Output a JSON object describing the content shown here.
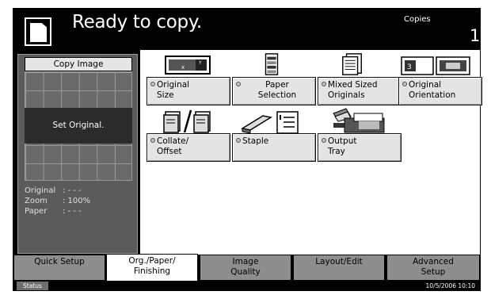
{
  "header": {
    "status_message": "Ready to copy.",
    "copies_label": "Copies",
    "copies_value": "1"
  },
  "preview": {
    "title": "Copy Image",
    "message": "Set Original.",
    "info": [
      {
        "label": "Original",
        "value": ": - - -"
      },
      {
        "label": "Zoom",
        "value": ": 100%"
      },
      {
        "label": "Paper",
        "value": ": - - -"
      }
    ]
  },
  "functions": {
    "original_size": "Original\nSize",
    "paper_selection": "Paper\nSelection",
    "mixed_sized_originals": "Mixed Sized\nOriginals",
    "original_orientation": "Original\nOrientation",
    "collate_offset": "Collate/\nOffset",
    "staple": "Staple",
    "output_tray": "Output\nTray"
  },
  "tabs": {
    "quick_setup": "Quick Setup",
    "org_paper_finishing": "Org./Paper/\nFinishing",
    "image_quality": "Image\nQuality",
    "layout_edit": "Layout/Edit",
    "advanced_setup": "Advanced\nSetup",
    "active": "org_paper_finishing"
  },
  "statusbar": {
    "status_label": "Status",
    "datetime": "10/5/2006   10:10"
  },
  "icons": {
    "document": "document-icon",
    "original_size": "original-size-icon",
    "paper_selection": "paper-cassette-icon",
    "mixed_sized": "mixed-originals-icon",
    "orientation": "orientation-icon",
    "collate": "collate-icon",
    "staple": "staple-icon",
    "output_tray": "output-tray-icon"
  }
}
